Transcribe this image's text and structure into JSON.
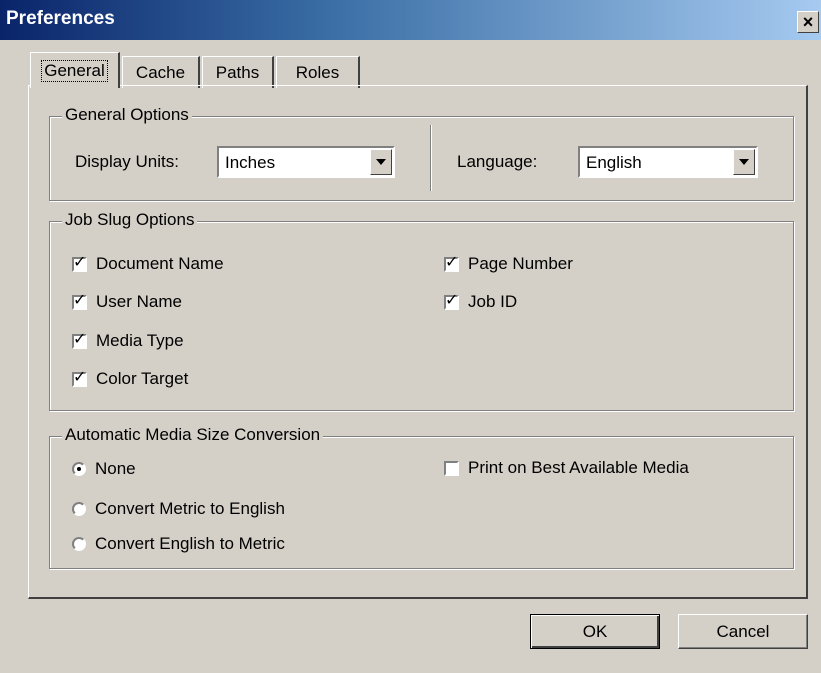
{
  "window": {
    "title": "Preferences",
    "close_glyph": "×"
  },
  "tabs": [
    {
      "label": "General",
      "active": true
    },
    {
      "label": "Cache",
      "active": false
    },
    {
      "label": "Paths",
      "active": false
    },
    {
      "label": "Roles",
      "active": false
    }
  ],
  "general_options": {
    "legend": "General Options",
    "display_units_label": "Display Units:",
    "display_units_value": "Inches",
    "language_label": "Language:",
    "language_value": "English"
  },
  "job_slug_options": {
    "legend": "Job Slug Options",
    "items": [
      {
        "label": "Document Name",
        "checked": true
      },
      {
        "label": "User Name",
        "checked": true
      },
      {
        "label": "Media Type",
        "checked": true
      },
      {
        "label": "Color Target",
        "checked": true
      },
      {
        "label": "Page Number",
        "checked": true
      },
      {
        "label": "Job ID",
        "checked": true
      }
    ]
  },
  "media_conversion": {
    "legend": "Automatic Media Size Conversion",
    "radios": [
      {
        "label": "None",
        "selected": true
      },
      {
        "label": "Convert Metric to English",
        "selected": false
      },
      {
        "label": "Convert English to Metric",
        "selected": false
      }
    ],
    "best_media": {
      "label": "Print on Best Available Media",
      "checked": false
    }
  },
  "buttons": {
    "ok": "OK",
    "cancel": "Cancel"
  },
  "check_glyph": "✓"
}
